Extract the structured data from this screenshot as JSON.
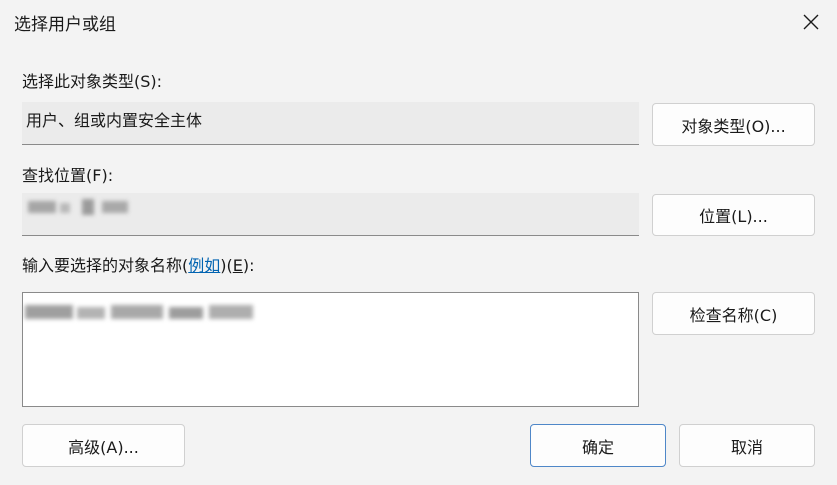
{
  "window": {
    "title": "选择用户或组",
    "close_icon": "close-icon"
  },
  "object_type": {
    "label": "选择此对象类型(S):",
    "value": "用户、组或内置安全主体",
    "button": "对象类型(O)..."
  },
  "location": {
    "label": "查找位置(F):",
    "value_redacted": true,
    "button": "位置(L)..."
  },
  "names": {
    "label_prefix": "输入要选择的对象名称(",
    "label_link": "例如",
    "label_suffix_open": ")(",
    "label_suffix_key": "E",
    "label_suffix_close": "):",
    "value_redacted": true,
    "check_button": "检查名称(C)"
  },
  "footer": {
    "advanced_button": "高级(A)...",
    "ok_button": "确定",
    "cancel_button": "取消"
  },
  "colors": {
    "background": "#f3f3f3",
    "field_readonly": "#ebebeb",
    "link": "#0063b1",
    "primary_border": "#4f87c8"
  }
}
